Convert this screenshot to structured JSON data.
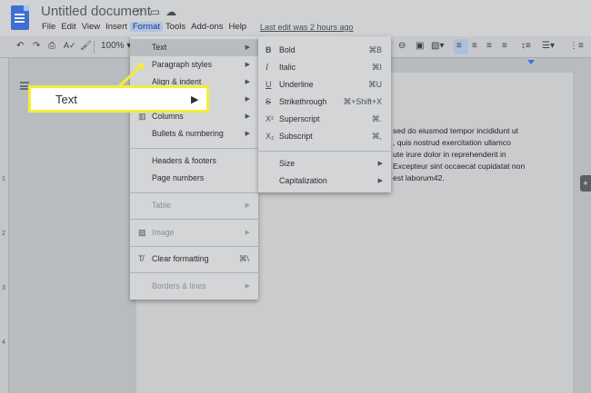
{
  "app": {
    "title": "Untitled document",
    "last_edit": "Last edit was 2 hours ago"
  },
  "menubar": [
    "File",
    "Edit",
    "View",
    "Insert",
    "Format",
    "Tools",
    "Add-ons",
    "Help"
  ],
  "menubar_active": "Format",
  "toolbar": {
    "zoom": "100%",
    "icons": [
      "undo-icon",
      "redo-icon",
      "print-icon",
      "spellcheck-icon",
      "paint-format-icon",
      "link-icon",
      "comment-icon",
      "image-icon",
      "align-left-icon",
      "align-center-icon",
      "align-right-icon",
      "align-justify-icon",
      "line-spacing-icon",
      "checklist-icon"
    ]
  },
  "ruler": [
    "1",
    "2",
    "3",
    "4"
  ],
  "format_menu": {
    "text": "Text",
    "paragraph_styles": "Paragraph styles",
    "align_indent": "Align & indent",
    "columns": "Columns",
    "bullets_numbering": "Bullets & numbering",
    "headers_footers": "Headers & footers",
    "page_numbers": "Page numbers",
    "table": "Table",
    "image": "Image",
    "clear_formatting": "Clear formatting",
    "clear_formatting_shortcut": "⌘\\",
    "borders_lines": "Borders & lines"
  },
  "text_submenu": {
    "bold": "Bold",
    "bold_shortcut": "⌘B",
    "italic": "Italic",
    "italic_shortcut": "⌘I",
    "underline": "Underline",
    "underline_shortcut": "⌘U",
    "strikethrough": "Strikethrough",
    "strikethrough_shortcut": "⌘+Shift+X",
    "superscript": "Superscript",
    "superscript_shortcut": "⌘.",
    "subscript": "Subscript",
    "subscript_shortcut": "⌘,",
    "size": "Size",
    "capitalization": "Capitalization"
  },
  "document": {
    "lines": [
      "sed do eiusmod tempor incididunt ut",
      ", quis nostrud exercitation ullamco",
      "ute irure dolor in reprehenderit in",
      " Excepteur sint occaecat cupidatat non",
      "est laborum42."
    ]
  },
  "callout": {
    "label": "Text",
    "arrow": "▶"
  },
  "colors": {
    "callout_border": "#f4ec3a",
    "accent": "#3f6fd0"
  }
}
